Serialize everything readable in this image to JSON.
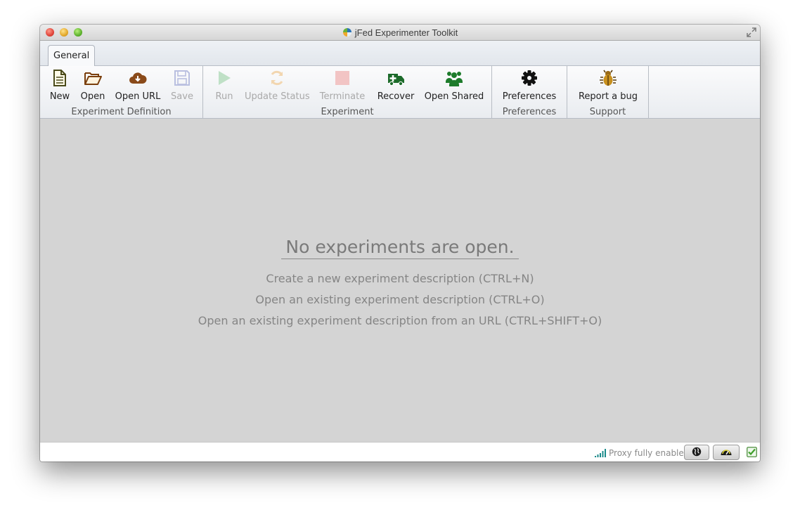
{
  "window": {
    "title": "jFed Experimenter Toolkit"
  },
  "tabs": [
    {
      "label": "General"
    }
  ],
  "ribbon": {
    "groups": [
      {
        "label": "Experiment Definition",
        "buttons": [
          {
            "label": "New",
            "icon": "new-document-icon",
            "enabled": true
          },
          {
            "label": "Open",
            "icon": "folder-open-icon",
            "enabled": true
          },
          {
            "label": "Open URL",
            "icon": "cloud-download-icon",
            "enabled": true
          },
          {
            "label": "Save",
            "icon": "floppy-disk-icon",
            "enabled": false
          }
        ]
      },
      {
        "label": "Experiment",
        "buttons": [
          {
            "label": "Run",
            "icon": "play-icon",
            "enabled": false
          },
          {
            "label": "Update Status",
            "icon": "refresh-icon",
            "enabled": false
          },
          {
            "label": "Terminate",
            "icon": "stop-icon",
            "enabled": false
          },
          {
            "label": "Recover",
            "icon": "ambulance-icon",
            "enabled": true
          },
          {
            "label": "Open Shared",
            "icon": "group-users-icon",
            "enabled": true
          }
        ]
      },
      {
        "label": "Preferences",
        "buttons": [
          {
            "label": "Preferences",
            "icon": "gear-icon",
            "enabled": true
          }
        ]
      },
      {
        "label": "Support",
        "buttons": [
          {
            "label": "Report a bug",
            "icon": "bug-icon",
            "enabled": true
          }
        ]
      }
    ]
  },
  "main": {
    "empty_title": "No experiments are open.",
    "hints": [
      "Create a new experiment description (CTRL+N)",
      "Open an existing experiment description (CTRL+O)",
      "Open an existing experiment description from an URL (CTRL+SHIFT+O)"
    ]
  },
  "status": {
    "proxy_text": "Proxy fully enabled",
    "icons": [
      "signal-bars-icon",
      "globe-icon",
      "speedometer-icon",
      "checkbox-icon"
    ],
    "colors": {
      "signal": "#1a8a8a",
      "check": "#3f9f2a"
    }
  }
}
